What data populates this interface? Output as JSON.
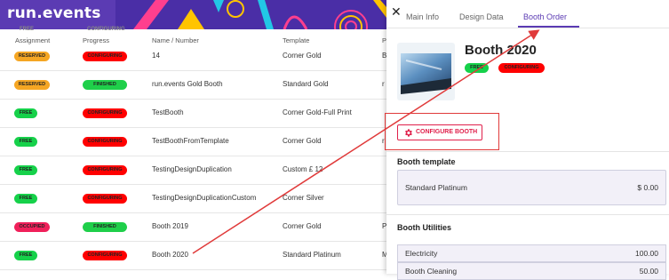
{
  "brand": {
    "logo_text": "run.events"
  },
  "table": {
    "top_labels": {
      "assignment": "FREE",
      "progress": "CONFIGURING"
    },
    "headers": {
      "assignment": "Assignment",
      "progress": "Progress",
      "name": "Name / Number",
      "template": "Template",
      "extra": "P"
    },
    "rows": [
      {
        "assignment": "RESERVED",
        "assignment_color": "#f5a623",
        "progress": "CONFIGURING",
        "progress_color": "#ff0000",
        "name": "14",
        "template": "Corner Gold",
        "extra": "B"
      },
      {
        "assignment": "RESERVED",
        "assignment_color": "#f5a623",
        "progress": "FINISHED",
        "progress_color": "#1fcf4a",
        "name": "run.events Gold Booth",
        "template": "Standard Gold",
        "extra": "r"
      },
      {
        "assignment": "FREE",
        "assignment_color": "#16d14a",
        "progress": "CONFIGURING",
        "progress_color": "#ff0000",
        "name": "TestBooth",
        "template": "Corner Gold-Full Print",
        "extra": ""
      },
      {
        "assignment": "FREE",
        "assignment_color": "#16d14a",
        "progress": "CONFIGURING",
        "progress_color": "#ff0000",
        "name": "TestBoothFromTemplate",
        "template": "Corner Gold",
        "extra": "r"
      },
      {
        "assignment": "FREE",
        "assignment_color": "#16d14a",
        "progress": "CONFIGURING",
        "progress_color": "#ff0000",
        "name": "TestingDesignDuplication",
        "template": "Custom £ 12",
        "extra": ""
      },
      {
        "assignment": "FREE",
        "assignment_color": "#16d14a",
        "progress": "CONFIGURING",
        "progress_color": "#ff0000",
        "name": "TestingDesignDuplicationCustom",
        "template": "Corner Silver",
        "extra": ""
      },
      {
        "assignment": "OCCUPIED",
        "assignment_color": "#f0205a",
        "progress": "FINISHED",
        "progress_color": "#1fcf4a",
        "name": "Booth 2019",
        "template": "Corner Gold",
        "extra": "P"
      },
      {
        "assignment": "FREE",
        "assignment_color": "#16d14a",
        "progress": "CONFIGURING",
        "progress_color": "#ff0000",
        "name": "Booth 2020",
        "template": "Standard Platinum",
        "extra": "M"
      }
    ]
  },
  "panel": {
    "close_icon": "close-icon",
    "tabs": [
      "Main Info",
      "Design Data",
      "Booth Order"
    ],
    "active_tab": "Booth Order",
    "booth_title": "Booth 2020",
    "status_badges": [
      {
        "label": "FREE",
        "color": "#16d14a"
      },
      {
        "label": "CONFIGURING",
        "color": "#ff0000"
      }
    ],
    "configure_button": "CONFIGURE BOOTH",
    "configure_icon": "gear-icon",
    "template_section": {
      "title": "Booth template",
      "name": "Standard Platinum",
      "price": "$ 0.00"
    },
    "utilities_section": {
      "title": "Booth Utilities",
      "items": [
        {
          "label": "Electricity",
          "value": "100.00"
        },
        {
          "label": "Booth Cleaning",
          "value": "50.00"
        }
      ]
    }
  },
  "colors": {
    "brand": "#5b3bb3",
    "accent": "#e0204b",
    "annotation": "#e03a3a"
  }
}
